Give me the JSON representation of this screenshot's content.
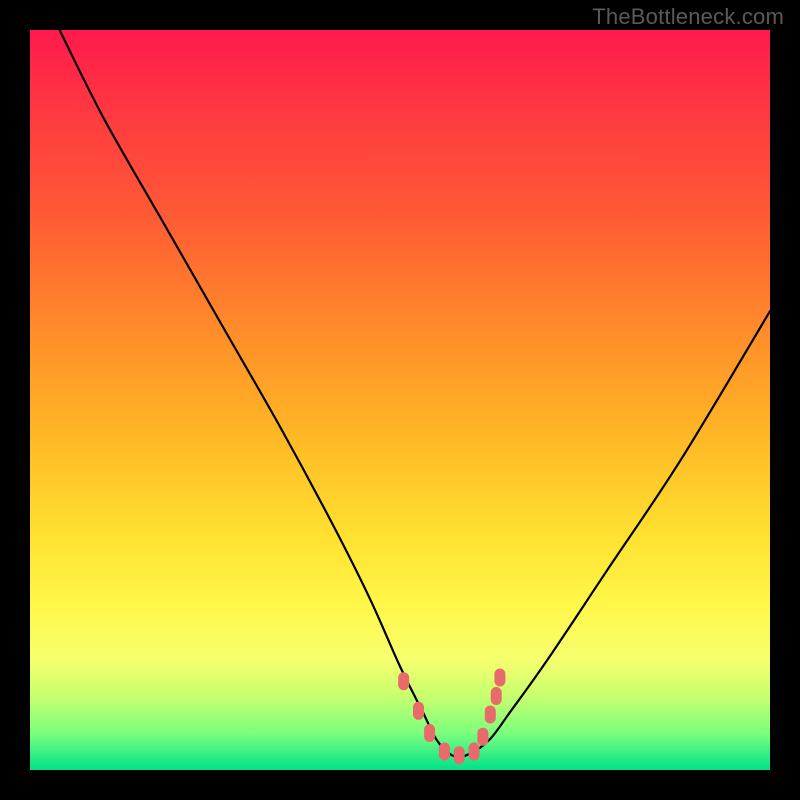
{
  "watermark": "TheBottleneck.com",
  "chart_data": {
    "type": "line",
    "title": "",
    "xlabel": "",
    "ylabel": "",
    "xlim": [
      0,
      100
    ],
    "ylim": [
      0,
      100
    ],
    "grid": false,
    "series": [
      {
        "name": "bottleneck-curve",
        "x": [
          4,
          10,
          18,
          26,
          34,
          41,
          46,
          50,
          53,
          55,
          57,
          59,
          62,
          65,
          70,
          78,
          88,
          100
        ],
        "y": [
          100,
          88,
          74,
          60,
          46,
          33,
          23,
          14,
          8,
          4,
          2,
          2,
          4,
          8,
          15,
          27,
          42,
          62
        ]
      }
    ],
    "markers": {
      "name": "highlighted-points",
      "color": "#e86a6a",
      "x": [
        50.5,
        52.5,
        54,
        56,
        58,
        60,
        61.2,
        62.2,
        63,
        63.5
      ],
      "y": [
        12,
        8,
        5,
        2.5,
        2,
        2.5,
        4.5,
        7.5,
        10,
        12.5
      ]
    },
    "background_gradient": {
      "top": "#ff1a4d",
      "mid": "#ffe030",
      "bottom": "#00e28a"
    }
  }
}
